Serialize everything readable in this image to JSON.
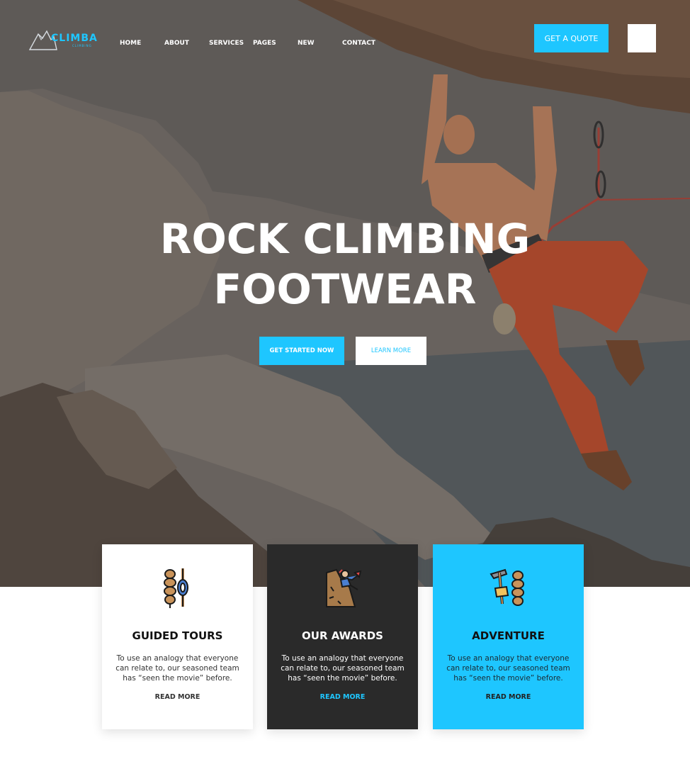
{
  "brand": {
    "name": "CLIMBA",
    "tagline": "CLIMBING",
    "accent": "#1ec6ff"
  },
  "nav": {
    "items": [
      {
        "label": "HOME"
      },
      {
        "label": "ABOUT"
      },
      {
        "label": "SERVICES"
      },
      {
        "label": "PAGES"
      },
      {
        "label": "NEW"
      },
      {
        "label": "CONTACT"
      }
    ],
    "quote_label": "GET A QUOTE",
    "menu_icon": "menu-icon"
  },
  "hero": {
    "title_line1": "ROCK CLIMBING",
    "title_line2": "FOOTWEAR",
    "primary_label": "GET STARTED NOW",
    "secondary_label": "LEARN MORE"
  },
  "cards": [
    {
      "icon": "rope-carabiner-icon",
      "title": "GUIDED TOURS",
      "description": "To use an analogy that everyone can relate to, our seasoned team has “seen the movie” before.",
      "link": "READ MORE",
      "bg": "#ffffff"
    },
    {
      "icon": "climber-on-rock-icon",
      "title": "OUR AWARDS",
      "description": "To use an analogy that everyone can relate to, our seasoned team has “seen the movie” before.",
      "link": "READ MORE",
      "bg": "#2a2a2a"
    },
    {
      "icon": "ice-axe-rope-icon",
      "title": "ADVENTURE",
      "description": "To use an analogy that everyone can relate to, our seasoned team has “seen the movie” before.",
      "link": "READ MORE",
      "bg": "#1ec6ff"
    }
  ]
}
